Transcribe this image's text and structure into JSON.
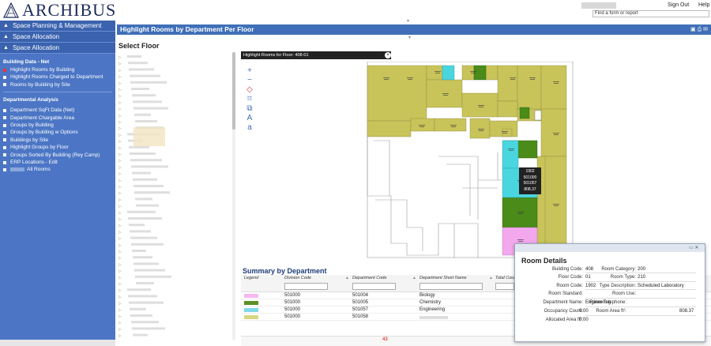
{
  "header": {
    "logo_text": "ARCHIBUS",
    "signout_label": "Sign Out",
    "help_label": "Help",
    "find_placeholder": "Find a form or report"
  },
  "nav": {
    "groups": [
      {
        "label": "Space Planning & Management"
      },
      {
        "label": "Space Allocation"
      },
      {
        "label": "Space Allocation"
      }
    ],
    "section1_title": "Building Data - Net",
    "section1_items": [
      {
        "label": "Highlight Rooms by Building",
        "active": true
      },
      {
        "label": "Highlight Rooms Charged to Department"
      },
      {
        "label": "Rooms by Building by Site"
      }
    ],
    "section2_title": "Departmental Analysis",
    "section2_items": [
      {
        "label": "Department SqFt Data (Net)"
      },
      {
        "label": "Department Chargable Area"
      },
      {
        "label": "Groups by Building"
      },
      {
        "label": "Groups by Building w Options"
      },
      {
        "label": "Buildings by Site"
      },
      {
        "label": "Highlight Groups by Floor"
      },
      {
        "label": "Groups Sorted By Building (Rey Camp)"
      },
      {
        "label": "ERP Locations - Edit"
      },
      {
        "label": "All Rooms"
      }
    ]
  },
  "main": {
    "title": "Highlight Rooms by Department Per Floor",
    "select_floor_title": "Select Floor"
  },
  "drawing": {
    "title": "Highlight Rooms for Floor: 408-01",
    "tools": [
      "+",
      "−",
      "◇",
      "⌑",
      "⧉",
      "A",
      "a"
    ],
    "room_label": [
      "1902",
      "501000",
      "501057",
      "808.37"
    ]
  },
  "summary": {
    "title": "Summary by Department",
    "columns": [
      "Legend",
      "Division Code",
      "Department Code",
      "Department Short Name",
      "Total Coun"
    ],
    "rows": [
      {
        "color": "#f6b8ee",
        "division": "501000",
        "department": "501004",
        "short_name": "Biology"
      },
      {
        "color": "#5b8f24",
        "division": "501000",
        "department": "501005",
        "short_name": "Chemistry"
      },
      {
        "color": "#80d9e6",
        "division": "501000",
        "department": "501057",
        "short_name": "Engineering"
      },
      {
        "color": "#d7d784",
        "division": "501000",
        "department": "501058",
        "short_name": ""
      }
    ],
    "page_number": "43"
  },
  "room_details": {
    "title": "Room Details",
    "left": [
      {
        "label": "Building Code:",
        "value": "408"
      },
      {
        "label": "Floor Code:",
        "value": "01"
      },
      {
        "label": "Room Code:",
        "value": "1902"
      },
      {
        "label": "Room Standard:",
        "value": ""
      },
      {
        "label": "Department Name:",
        "value": "Engineering"
      },
      {
        "label": "Occupancy Count:",
        "value": "0.00"
      },
      {
        "label": "Allocated Area ft²:",
        "value": "0.00"
      }
    ],
    "right": [
      {
        "label": "Room Category:",
        "value": "200"
      },
      {
        "label": "Room Type:",
        "value": "210"
      },
      {
        "label": "Type Description:",
        "value": "Scheduled Laboratory"
      },
      {
        "label": "Room Use:",
        "value": ""
      },
      {
        "label": "Room Telephone:",
        "value": ""
      },
      {
        "label": "Room Area ft²:",
        "value": "808.37"
      }
    ]
  },
  "colors": {
    "nav_bg": "#4c76c5",
    "title_bar": "#3f6fb8",
    "room_yellow": "#c8c45a",
    "room_green": "#4a8b1a",
    "room_cyan": "#49d6df",
    "room_pink": "#f3a8ee"
  }
}
